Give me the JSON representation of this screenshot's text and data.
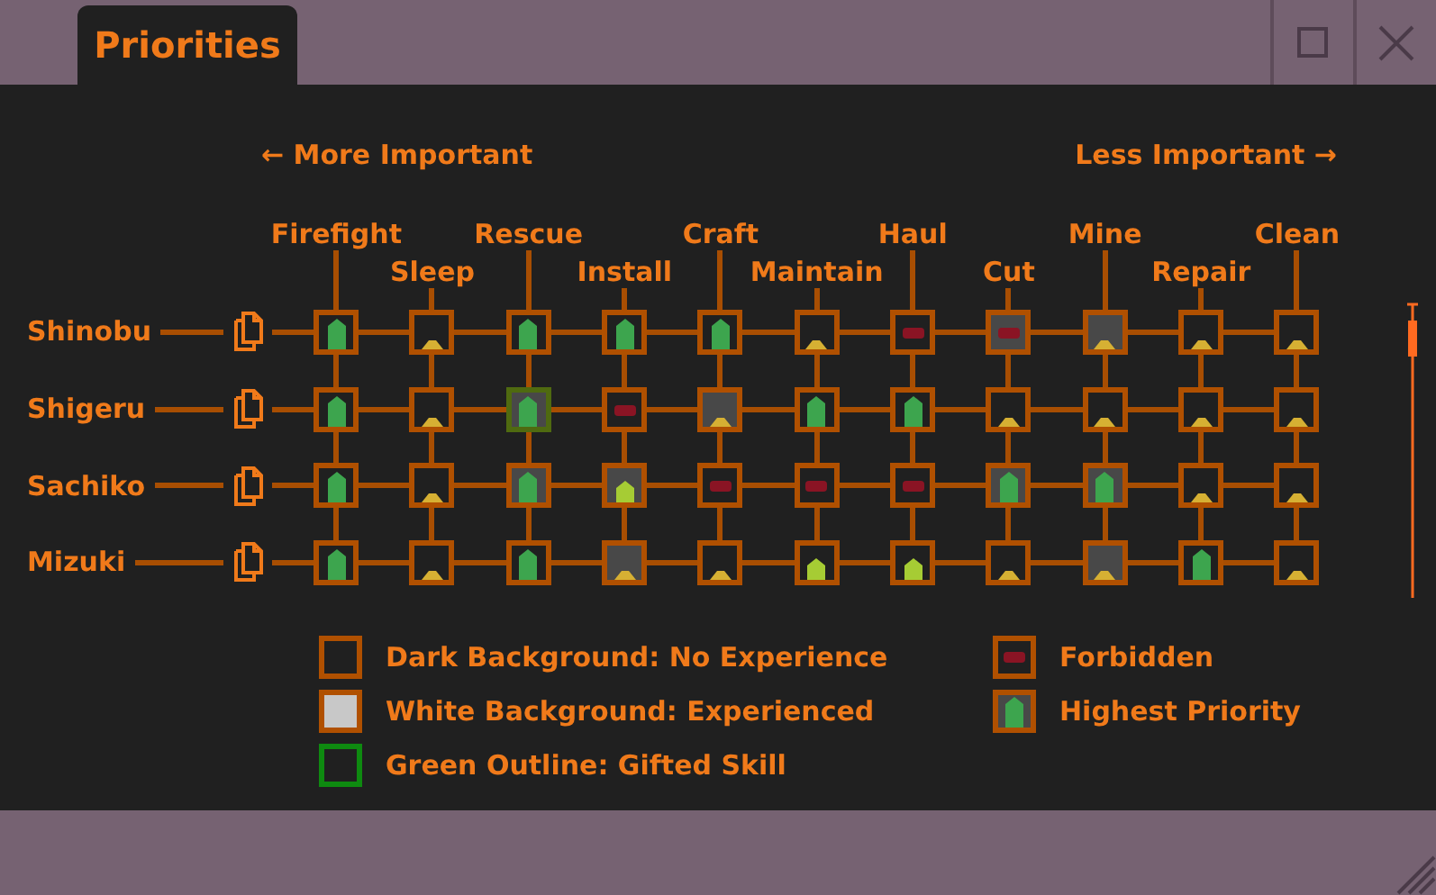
{
  "window": {
    "title": "Priorities"
  },
  "axis": {
    "left": "← More Important",
    "right": "Less Important →"
  },
  "jobs": [
    "Firefight",
    "Sleep",
    "Rescue",
    "Install",
    "Craft",
    "Maintain",
    "Haul",
    "Cut",
    "Mine",
    "Repair",
    "Clean"
  ],
  "workers": [
    {
      "name": "Shinobu",
      "cells": [
        {
          "kind": "high",
          "experienced": false,
          "gifted": false
        },
        {
          "kind": "low",
          "experienced": false,
          "gifted": false
        },
        {
          "kind": "high",
          "experienced": false,
          "gifted": false
        },
        {
          "kind": "high",
          "experienced": false,
          "gifted": false
        },
        {
          "kind": "high",
          "experienced": false,
          "gifted": false
        },
        {
          "kind": "low",
          "experienced": false,
          "gifted": false
        },
        {
          "kind": "forbidden",
          "experienced": false,
          "gifted": false
        },
        {
          "kind": "forbidden",
          "experienced": true,
          "gifted": false
        },
        {
          "kind": "low",
          "experienced": true,
          "gifted": false
        },
        {
          "kind": "low",
          "experienced": false,
          "gifted": false
        },
        {
          "kind": "low",
          "experienced": false,
          "gifted": false
        }
      ]
    },
    {
      "name": "Shigeru",
      "cells": [
        {
          "kind": "high",
          "experienced": false,
          "gifted": false
        },
        {
          "kind": "low",
          "experienced": false,
          "gifted": false
        },
        {
          "kind": "high",
          "experienced": true,
          "gifted": true
        },
        {
          "kind": "forbidden",
          "experienced": false,
          "gifted": false
        },
        {
          "kind": "low",
          "experienced": true,
          "gifted": false
        },
        {
          "kind": "high",
          "experienced": false,
          "gifted": false
        },
        {
          "kind": "high",
          "experienced": false,
          "gifted": false
        },
        {
          "kind": "low",
          "experienced": false,
          "gifted": false
        },
        {
          "kind": "low",
          "experienced": false,
          "gifted": false
        },
        {
          "kind": "low",
          "experienced": false,
          "gifted": false
        },
        {
          "kind": "low",
          "experienced": false,
          "gifted": false
        }
      ]
    },
    {
      "name": "Sachiko",
      "cells": [
        {
          "kind": "high",
          "experienced": false,
          "gifted": false
        },
        {
          "kind": "low",
          "experienced": false,
          "gifted": false
        },
        {
          "kind": "high",
          "experienced": true,
          "gifted": false
        },
        {
          "kind": "medium",
          "experienced": true,
          "gifted": false
        },
        {
          "kind": "forbidden",
          "experienced": false,
          "gifted": false
        },
        {
          "kind": "forbidden",
          "experienced": false,
          "gifted": false
        },
        {
          "kind": "forbidden",
          "experienced": false,
          "gifted": false
        },
        {
          "kind": "high",
          "experienced": true,
          "gifted": false
        },
        {
          "kind": "high",
          "experienced": true,
          "gifted": false
        },
        {
          "kind": "low",
          "experienced": false,
          "gifted": false
        },
        {
          "kind": "low",
          "experienced": false,
          "gifted": false
        }
      ]
    },
    {
      "name": "Mizuki",
      "cells": [
        {
          "kind": "high",
          "experienced": false,
          "gifted": false
        },
        {
          "kind": "low",
          "experienced": false,
          "gifted": false
        },
        {
          "kind": "high",
          "experienced": false,
          "gifted": false
        },
        {
          "kind": "low",
          "experienced": true,
          "gifted": false
        },
        {
          "kind": "low",
          "experienced": false,
          "gifted": false
        },
        {
          "kind": "medium",
          "experienced": false,
          "gifted": false
        },
        {
          "kind": "medium",
          "experienced": false,
          "gifted": false
        },
        {
          "kind": "low",
          "experienced": false,
          "gifted": false
        },
        {
          "kind": "low",
          "experienced": true,
          "gifted": false
        },
        {
          "kind": "high",
          "experienced": false,
          "gifted": false
        },
        {
          "kind": "low",
          "experienced": false,
          "gifted": false
        }
      ]
    }
  ],
  "legend": [
    {
      "kind": "dark",
      "label": "Dark Background: No Experience"
    },
    {
      "kind": "forbidden",
      "label": "Forbidden"
    },
    {
      "kind": "experienced",
      "label": "White Background: Experienced"
    },
    {
      "kind": "highest",
      "label": "Highest Priority"
    },
    {
      "kind": "gifted",
      "label": "Green Outline: Gifted Skill"
    }
  ]
}
